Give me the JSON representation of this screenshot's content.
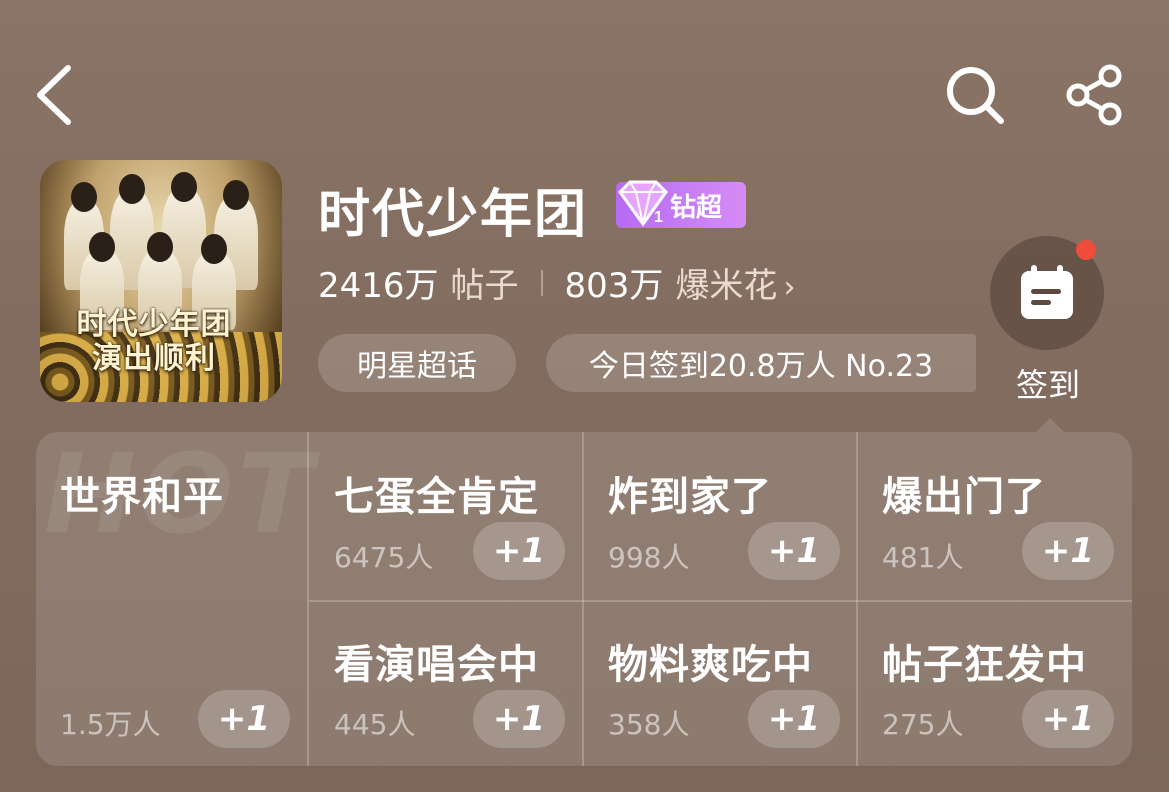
{
  "topbar": {
    "back_icon": "chevron-left-icon",
    "search_icon": "search-icon",
    "share_icon": "share-icon"
  },
  "header": {
    "cover_text_line1": "时代少年团",
    "cover_text_line2": "演出顺利",
    "title": "时代少年团",
    "badge_level": "1",
    "badge_label": "钻超",
    "posts_count": "2416万",
    "posts_label": "帖子",
    "popcorn_count": "803万",
    "popcorn_label": "爆米花",
    "popcorn_chevron": "›",
    "category_chip": "明星超话",
    "checkin_info_chip": "今日签到20.8万人 No.23",
    "checkin_label": "签到"
  },
  "hot": {
    "watermark": "HOT",
    "items": [
      {
        "title": "世界和平",
        "count": "1.5万人",
        "action": "+1"
      },
      {
        "title": "七蛋全肯定",
        "count": "6475人",
        "action": "+1"
      },
      {
        "title": "炸到家了",
        "count": "998人",
        "action": "+1"
      },
      {
        "title": "爆出门了",
        "count": "481人",
        "action": "+1"
      },
      {
        "title": "看演唱会中",
        "count": "445人",
        "action": "+1"
      },
      {
        "title": "物料爽吃中",
        "count": "358人",
        "action": "+1"
      },
      {
        "title": "帖子狂发中",
        "count": "275人",
        "action": "+1"
      }
    ]
  },
  "colors": {
    "background": "#836d60",
    "badge": "#c27af3",
    "notification_dot": "#f04c3c"
  }
}
